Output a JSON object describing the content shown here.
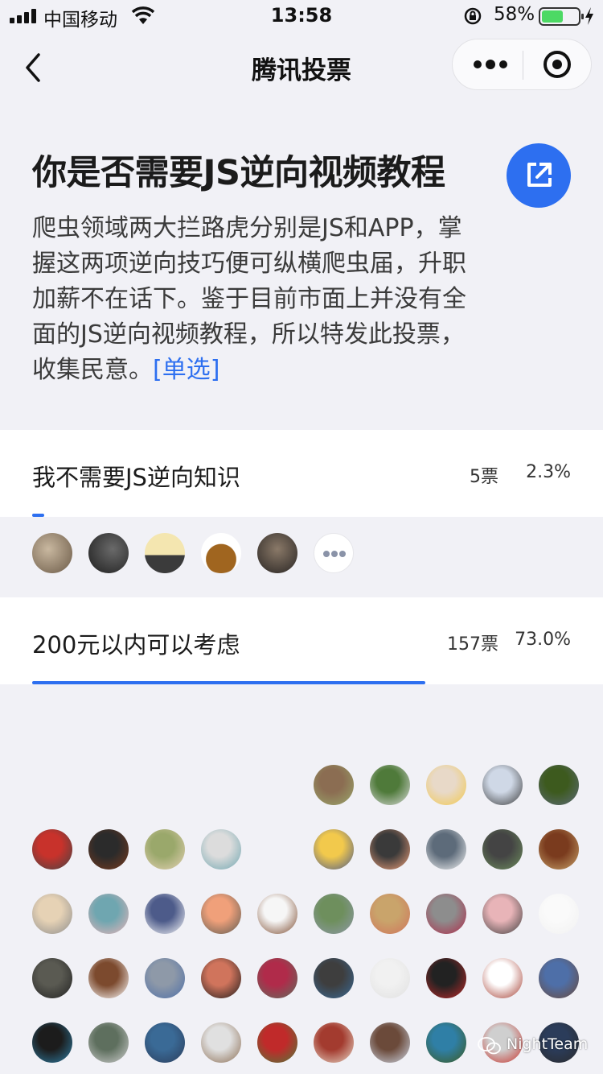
{
  "status_bar": {
    "carrier": "中国移动",
    "time": "13:58",
    "battery_pct": "58%",
    "battery_level": 0.58
  },
  "nav": {
    "title": "腾讯投票"
  },
  "poll": {
    "title": "你是否需要JS逆向视频教程",
    "description": "爬虫领域两大拦路虎分别是JS和APP，掌握这两项逆向技巧便可纵横爬虫届，升职加薪不在话下。鉴于目前市面上并没有全面的JS逆向视频教程，所以特发此投票，收集民意。",
    "type_tag": "[单选]"
  },
  "options": [
    {
      "label": "我不需要JS逆向知识",
      "votes": "5票",
      "percent": "2.3%",
      "fraction": 0.023
    },
    {
      "label": "200元以内可以考虑",
      "votes": "157票",
      "percent": "73.0%",
      "fraction": 0.73
    }
  ],
  "watermark": "NightTeam",
  "colors": {
    "accent": "#2d6ff0",
    "battery": "#4cd964",
    "background": "#f1f1f6"
  }
}
